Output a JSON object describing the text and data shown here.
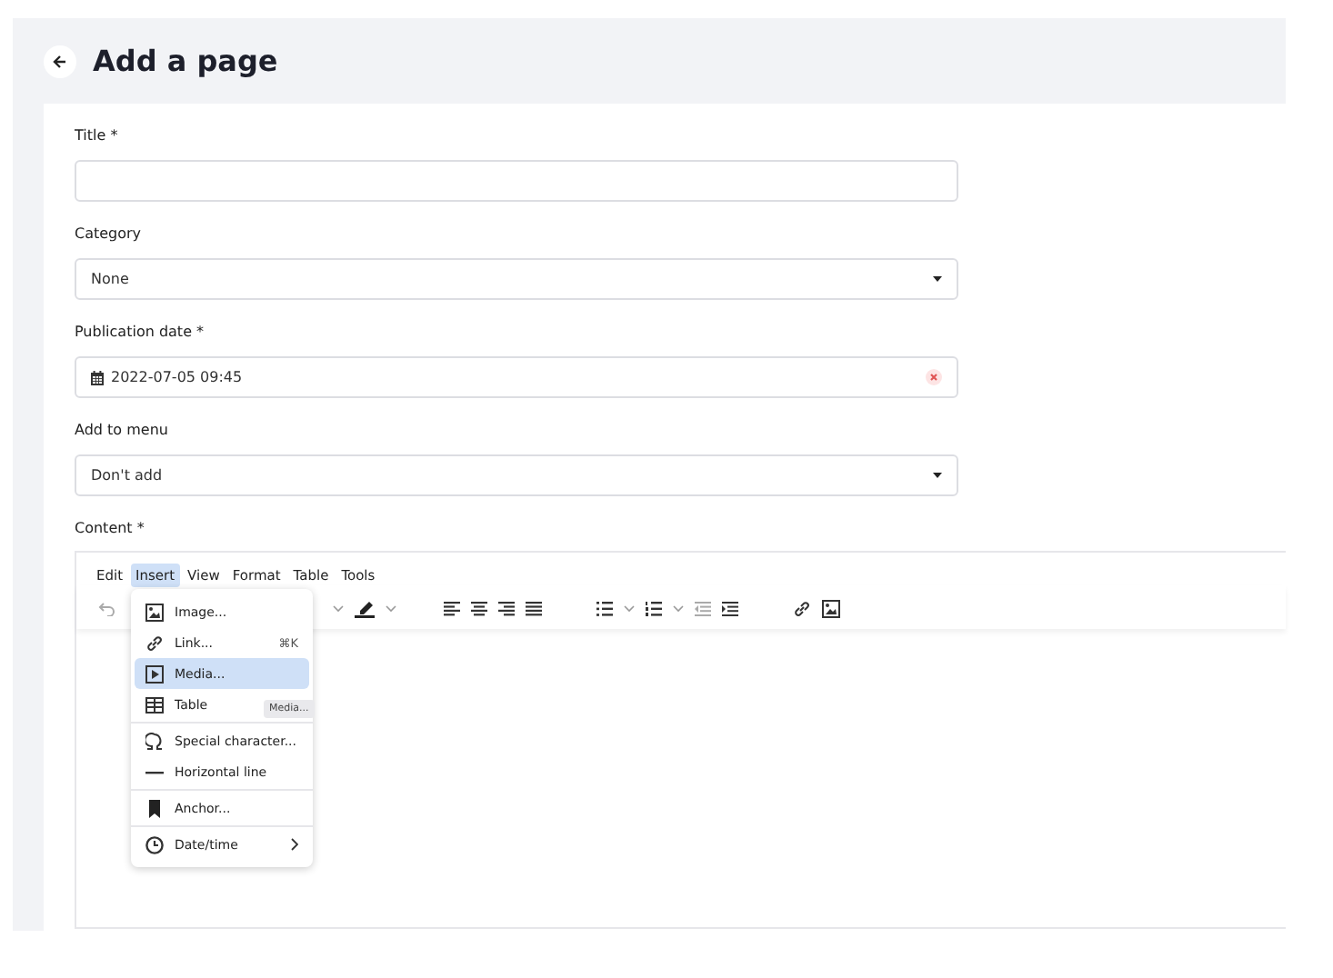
{
  "header": {
    "title": "Add a page"
  },
  "fields": [
    {
      "label": "Title *",
      "kind": "text"
    },
    {
      "label": "Category",
      "kind": "select",
      "value": "None"
    },
    {
      "label": "Publication date *",
      "kind": "date",
      "value": "2022-07-05 09:45",
      "clearable": true
    },
    {
      "label": "Add to menu",
      "kind": "select",
      "value": "Don't add"
    }
  ],
  "editor": {
    "label": "Content *",
    "menubar": [
      {
        "label": "Edit",
        "selected": false
      },
      {
        "label": "Insert",
        "selected": true
      },
      {
        "label": "View",
        "selected": false
      },
      {
        "label": "Format",
        "selected": false
      },
      {
        "label": "Table",
        "selected": false
      },
      {
        "label": "Tools",
        "selected": false
      }
    ],
    "menu": {
      "groups": [
        [
          {
            "label": "Image...",
            "selected": false
          },
          {
            "label": "Link...",
            "shortcut": "⌘K",
            "selected": false
          },
          {
            "label": "Media...",
            "selected": true
          },
          {
            "label": "Table",
            "selected": false
          }
        ],
        [
          {
            "label": "Special character...",
            "selected": false
          },
          {
            "label": "Horizontal line",
            "selected": false
          }
        ],
        [
          {
            "label": "Anchor...",
            "selected": false
          }
        ],
        [
          {
            "label": "Date/time",
            "submenu": true,
            "selected": false
          }
        ]
      ]
    },
    "tooltip": "Media..."
  }
}
